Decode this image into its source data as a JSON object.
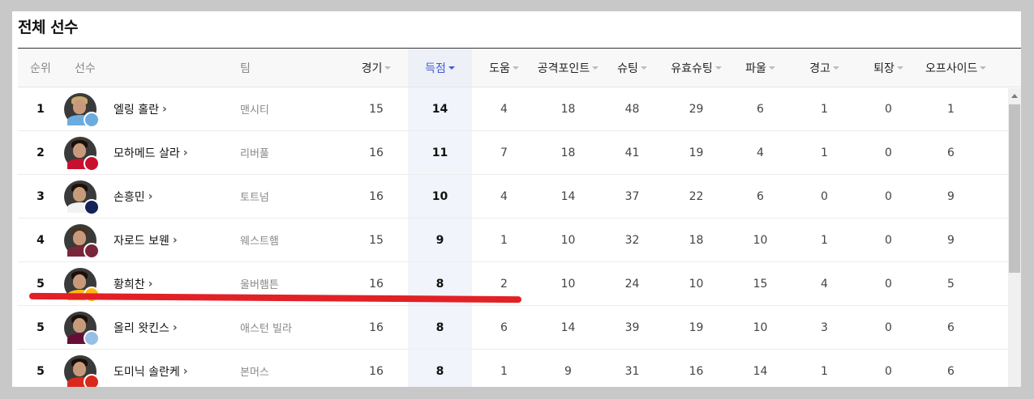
{
  "page": {
    "title": "전체 선수"
  },
  "columns": {
    "rank": "순위",
    "player": "선수",
    "team": "팀",
    "games": "경기",
    "goals": "득점",
    "assists": "도움",
    "attack_points": "공격포인트",
    "shots": "슈팅",
    "shots_on_target": "유효슈팅",
    "fouls": "파울",
    "yellow_cards": "경고",
    "red_cards": "퇴장",
    "offsides": "오프사이드"
  },
  "sorted_column": "goals",
  "rows": [
    {
      "rank": "1",
      "name": "엘링 홀란",
      "team": "맨시티",
      "games": "15",
      "goals": "14",
      "assists": "4",
      "attack_points": "18",
      "shots": "48",
      "shots_on_target": "29",
      "fouls": "6",
      "yellow_cards": "1",
      "red_cards": "0",
      "offsides": "1",
      "badge_color": "#6cabdd",
      "shirt_color": "#6cabdd",
      "hair_color": "#c9a86a"
    },
    {
      "rank": "2",
      "name": "모하메드 살라",
      "team": "리버풀",
      "games": "16",
      "goals": "11",
      "assists": "7",
      "attack_points": "18",
      "shots": "41",
      "shots_on_target": "19",
      "fouls": "4",
      "yellow_cards": "1",
      "red_cards": "0",
      "offsides": "6",
      "badge_color": "#c8102e",
      "shirt_color": "#c8102e",
      "hair_color": "#1a1008"
    },
    {
      "rank": "3",
      "name": "손흥민",
      "team": "토트넘",
      "games": "16",
      "goals": "10",
      "assists": "4",
      "attack_points": "14",
      "shots": "37",
      "shots_on_target": "22",
      "fouls": "6",
      "yellow_cards": "0",
      "red_cards": "0",
      "offsides": "9",
      "badge_color": "#132257",
      "shirt_color": "#f2f2f2",
      "hair_color": "#1a1008"
    },
    {
      "rank": "4",
      "name": "자로드 보웬",
      "team": "웨스트햄",
      "games": "15",
      "goals": "9",
      "assists": "1",
      "attack_points": "10",
      "shots": "32",
      "shots_on_target": "18",
      "fouls": "10",
      "yellow_cards": "1",
      "red_cards": "0",
      "offsides": "9",
      "badge_color": "#7a263a",
      "shirt_color": "#7a263a",
      "hair_color": "#4a3020"
    },
    {
      "rank": "5",
      "name": "황희찬",
      "team": "울버햄튼",
      "games": "16",
      "goals": "8",
      "assists": "2",
      "attack_points": "10",
      "shots": "24",
      "shots_on_target": "10",
      "fouls": "15",
      "yellow_cards": "4",
      "red_cards": "0",
      "offsides": "5",
      "badge_color": "#fdb913",
      "shirt_color": "#fdb913",
      "hair_color": "#1a1008"
    },
    {
      "rank": "5",
      "name": "올리 왓킨스",
      "team": "애스턴 빌라",
      "games": "16",
      "goals": "8",
      "assists": "6",
      "attack_points": "14",
      "shots": "39",
      "shots_on_target": "19",
      "fouls": "10",
      "yellow_cards": "3",
      "red_cards": "0",
      "offsides": "6",
      "badge_color": "#95bfe5",
      "shirt_color": "#670e36",
      "hair_color": "#1a1008"
    },
    {
      "rank": "5",
      "name": "도미닉 솔란케",
      "team": "본머스",
      "games": "16",
      "goals": "8",
      "assists": "1",
      "attack_points": "9",
      "shots": "31",
      "shots_on_target": "16",
      "fouls": "14",
      "yellow_cards": "1",
      "red_cards": "0",
      "offsides": "6",
      "badge_color": "#da291c",
      "shirt_color": "#da291c",
      "hair_color": "#1a1008"
    }
  ],
  "colors": {
    "accent": "#3d5bd6",
    "annotation": "#e22126"
  }
}
